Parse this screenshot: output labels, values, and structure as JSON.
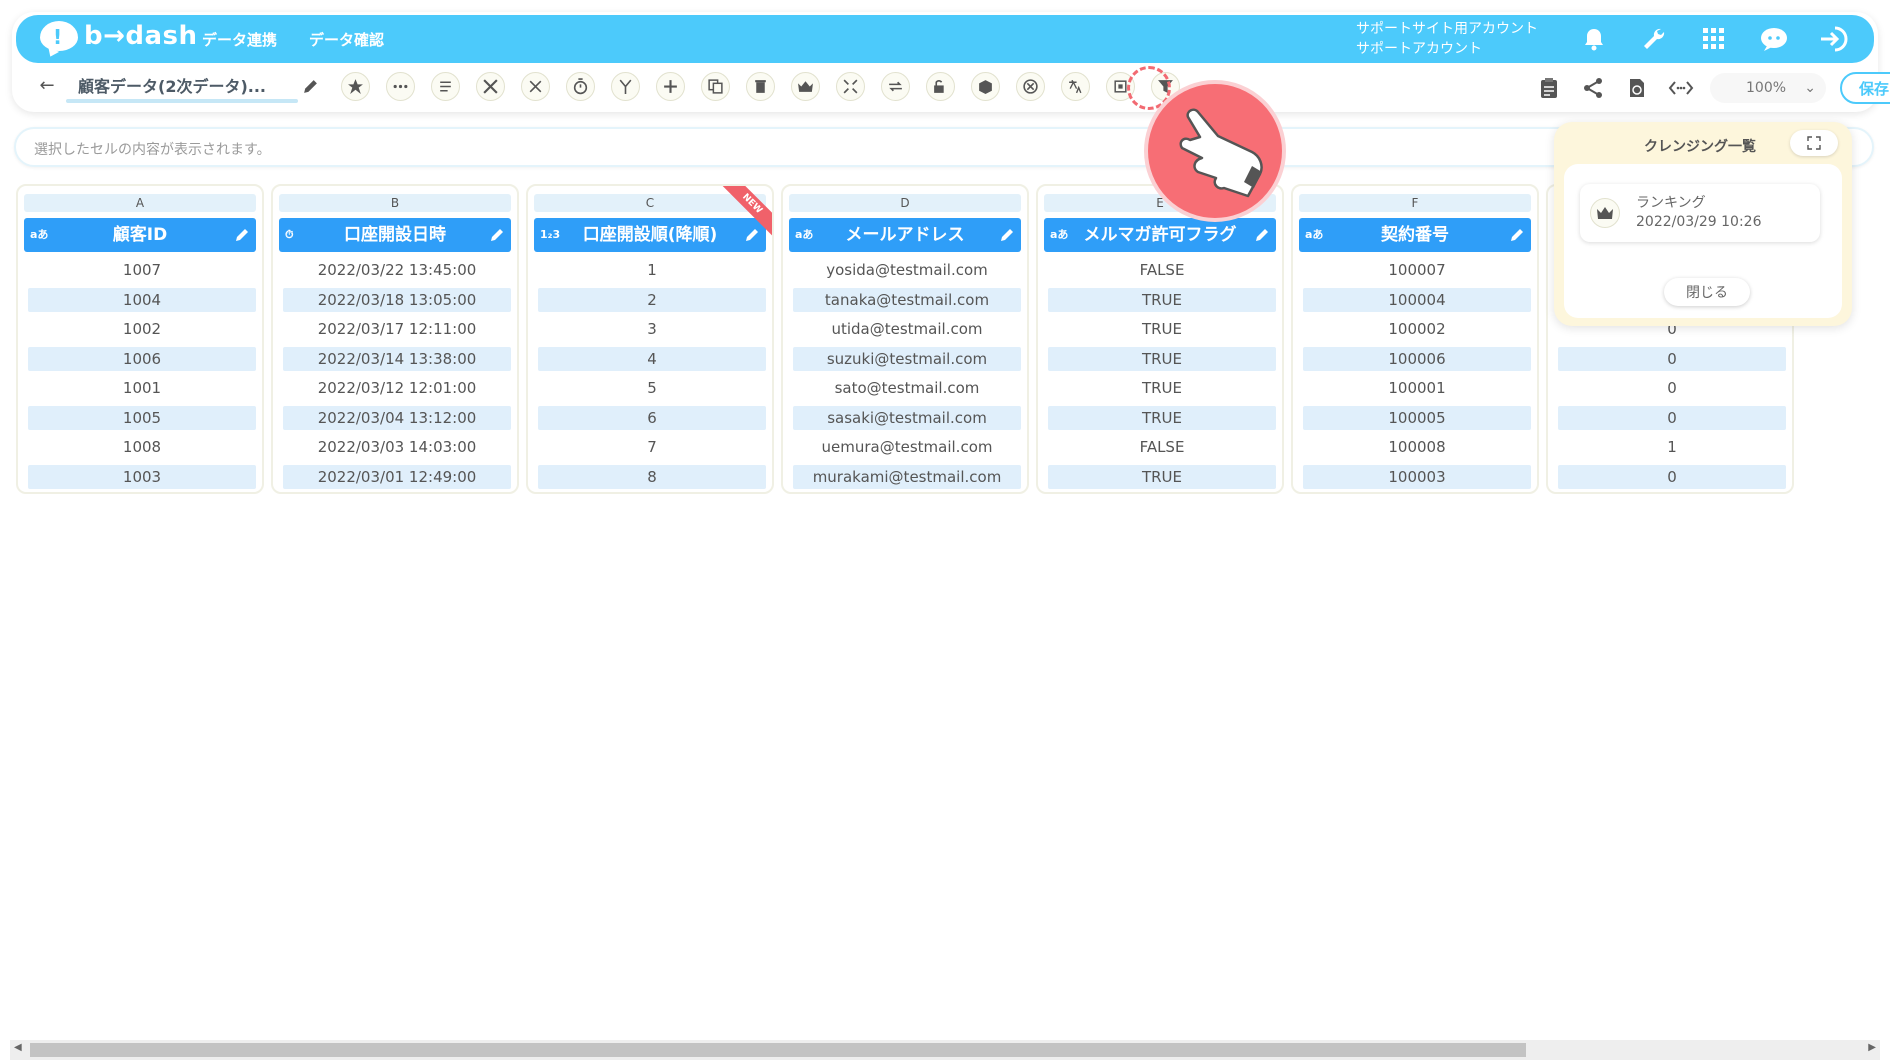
{
  "app": {
    "logo_text": "b→dash",
    "nav": [
      "データ連携",
      "データ確認"
    ],
    "account_line1": "サポートサイト用アカウント",
    "account_line2": "サポートアカウント"
  },
  "toolbar": {
    "file_title": "顧客データ(2次データ)...",
    "zoom": "100%",
    "save_label": "保存"
  },
  "formula_placeholder": "選択したセルの内容が表示されます。",
  "columns": [
    {
      "letter": "A",
      "type": "aあ",
      "name": "顧客ID",
      "cells": [
        "1007",
        "1004",
        "1002",
        "1006",
        "1001",
        "1005",
        "1008",
        "1003"
      ]
    },
    {
      "letter": "B",
      "type": "⏱",
      "name": "口座開設日時",
      "cells": [
        "2022/03/22 13:45:00",
        "2022/03/18 13:05:00",
        "2022/03/17 12:11:00",
        "2022/03/14 13:38:00",
        "2022/03/12 12:01:00",
        "2022/03/04 13:12:00",
        "2022/03/03 14:03:00",
        "2022/03/01 12:49:00"
      ]
    },
    {
      "letter": "C",
      "type": "1₂3",
      "name": "口座開設順(降順)",
      "badge": "NEW",
      "cells": [
        "1",
        "2",
        "3",
        "4",
        "5",
        "6",
        "7",
        "8"
      ]
    },
    {
      "letter": "D",
      "type": "aあ",
      "name": "メールアドレス",
      "cells": [
        "yosida@testmail.com",
        "tanaka@testmail.com",
        "utida@testmail.com",
        "suzuki@testmail.com",
        "sato@testmail.com",
        "sasaki@testmail.com",
        "uemura@testmail.com",
        "murakami@testmail.com"
      ]
    },
    {
      "letter": "E",
      "type": "aあ",
      "name": "メルマガ許可フラグ",
      "cells": [
        "FALSE",
        "TRUE",
        "TRUE",
        "TRUE",
        "TRUE",
        "TRUE",
        "FALSE",
        "TRUE"
      ]
    },
    {
      "letter": "F",
      "type": "aあ",
      "name": "契約番号",
      "cells": [
        "100007",
        "100004",
        "100002",
        "100006",
        "100001",
        "100005",
        "100008",
        "100003"
      ]
    },
    {
      "letter": "",
      "type": "",
      "name": "",
      "cells": [
        "",
        "",
        "0",
        "0",
        "0",
        "0",
        "1",
        "0"
      ]
    }
  ],
  "cleansing_panel": {
    "title": "クレンジング一覧",
    "item_name": "ランキング",
    "item_date": "2022/03/29 10:26",
    "close_label": "閉じる"
  },
  "colors": {
    "brand": "#4ccafb",
    "header_blue": "#2f9ef8",
    "alt_row": "#e0effb",
    "accent_red": "#f76e75"
  },
  "icons": [
    "bell-icon",
    "wrench-icon",
    "apps-grid-icon",
    "chat-icon",
    "logout-icon",
    "filter-icon",
    "crown-icon"
  ]
}
